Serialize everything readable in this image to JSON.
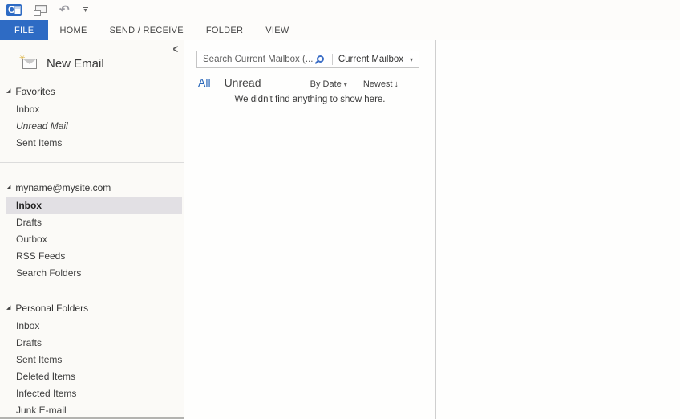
{
  "quick_access_toolbar": {
    "outlook_letter": "O",
    "undo_glyph": "↶",
    "customize_glyph": "▼",
    "sparkle_glyph": "✳"
  },
  "ribbon": {
    "tabs": [
      {
        "label": "FILE",
        "active": true
      },
      {
        "label": "HOME",
        "active": false
      },
      {
        "label": "SEND / RECEIVE",
        "active": false
      },
      {
        "label": "FOLDER",
        "active": false
      },
      {
        "label": "VIEW",
        "active": false
      }
    ]
  },
  "folder_pane": {
    "collapse_glyph": "<",
    "expanded_glyph": "◢",
    "new_email_label": "New Email",
    "sections": [
      {
        "title": "Favorites",
        "divider_above": false,
        "items": [
          {
            "label": "Inbox",
            "selected": false,
            "italic": false
          },
          {
            "label": "Unread Mail",
            "selected": false,
            "italic": true
          },
          {
            "label": "Sent Items",
            "selected": false,
            "italic": false
          }
        ]
      },
      {
        "title": "myname@mysite.com",
        "divider_above": true,
        "items": [
          {
            "label": "Inbox",
            "selected": true,
            "italic": false
          },
          {
            "label": "Drafts",
            "selected": false,
            "italic": false
          },
          {
            "label": "Outbox",
            "selected": false,
            "italic": false
          },
          {
            "label": "RSS Feeds",
            "selected": false,
            "italic": false
          },
          {
            "label": "Search Folders",
            "selected": false,
            "italic": false
          }
        ]
      },
      {
        "title": "Personal Folders",
        "divider_above": false,
        "items": [
          {
            "label": "Inbox",
            "selected": false,
            "italic": false
          },
          {
            "label": "Drafts",
            "selected": false,
            "italic": false
          },
          {
            "label": "Sent Items",
            "selected": false,
            "italic": false
          },
          {
            "label": "Deleted Items",
            "selected": false,
            "italic": false
          },
          {
            "label": "Infected Items",
            "selected": false,
            "italic": false
          },
          {
            "label": "Junk E-mail",
            "selected": false,
            "italic": false
          }
        ]
      }
    ]
  },
  "message_list": {
    "search": {
      "placeholder": "Search Current Mailbox (...",
      "scope": "Current Mailbox",
      "scope_caret": "▾"
    },
    "filters": {
      "all": "All",
      "unread": "Unread",
      "sort_by": "By Date",
      "sort_by_caret": "▾",
      "sort_order": "Newest",
      "sort_order_arrow": "↓"
    },
    "empty_message": "We didn't find anything to show here."
  },
  "colors": {
    "accent_blue": "#2e6bc4",
    "link_blue": "#2a67b8",
    "selected_row_bg": "#e2e0e4",
    "magnifier_blue": "#3c6ec6",
    "sidebar_bg": "#fbfaf7",
    "pane_bg": "#fefefd"
  }
}
